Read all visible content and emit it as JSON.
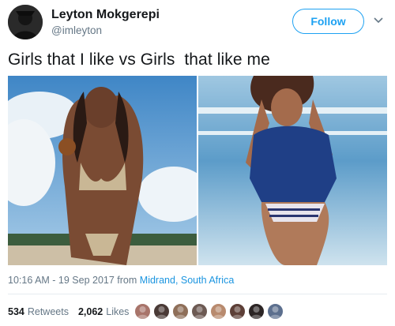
{
  "user": {
    "name": "Leyton Mokgerepi",
    "handle": "@imleyton"
  },
  "follow_label": "Follow",
  "tweet": {
    "text": "Girls that I like vs Girls  that like me"
  },
  "meta": {
    "time": "10:16 AM - 19 Sep 2017 from ",
    "location": "Midrand, South Africa"
  },
  "stats": {
    "retweets_count": "534",
    "retweets_label": "Retweets",
    "likes_count": "2,062",
    "likes_label": "Likes"
  },
  "likers": [
    {
      "color": "#a8746a"
    },
    {
      "color": "#4a3a36"
    },
    {
      "color": "#8f6f59"
    },
    {
      "color": "#6d5a53"
    },
    {
      "color": "#b88a6e"
    },
    {
      "color": "#5d3f37"
    },
    {
      "color": "#2c2525"
    },
    {
      "color": "#5c6f8e"
    }
  ],
  "colors": {
    "accent": "#1da1f2",
    "link": "#1b95e0",
    "muted": "#657786"
  },
  "icons": {
    "caret": "chevron-down-icon"
  }
}
